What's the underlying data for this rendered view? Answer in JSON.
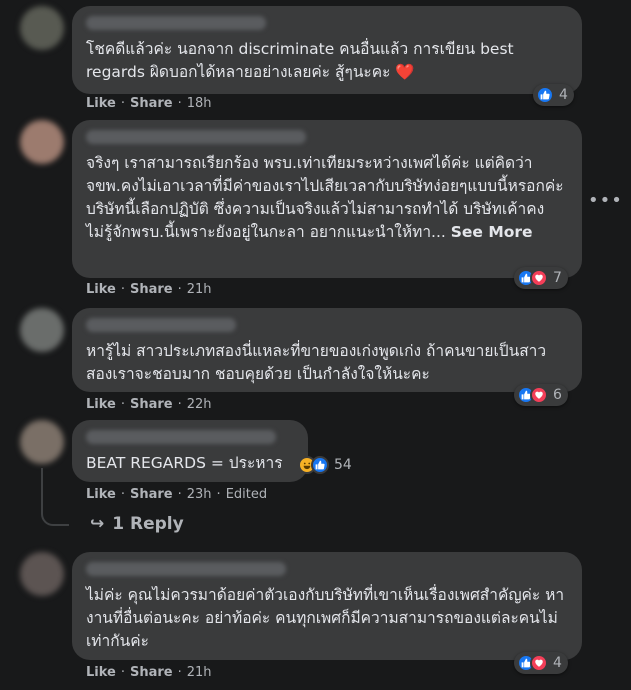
{
  "comments": [
    {
      "text": "โชคดีแล้วค่ะ นอกจาก discriminate คนอื่นแล้ว การเขียน best regards ผิดบอกได้หลายอย่างเลยค่ะ สู้ๆนะคะ",
      "emoji": "❤️",
      "like": "Like",
      "share": "Share",
      "time": "18h",
      "reaction_count": "4",
      "reaction_types": [
        "like"
      ]
    },
    {
      "text": "จริงๆ เราสามารถเรียกร้อง พรบ.เท่าเทียมระหว่างเพศได้ค่ะ แต่คิดว่า จขพ.คงไม่เอาเวลาที่มีค่าของเราไปเสียเวลากับบริษัทง่อยๆแบบนี้หรอกค่ะ บริษัทนี้เลือกปฏิบัติ ซึ่งความเป็นจริงแล้วไม่สามารถทำได้ บริษัทเค้าคงไม่รู้จักพรบ.นี้เพราะยังอยู่ในกะลา อยากแนะนำให้ทา...",
      "see_more": "See More",
      "like": "Like",
      "share": "Share",
      "time": "21h",
      "reaction_count": "7",
      "reaction_types": [
        "like",
        "love"
      ]
    },
    {
      "text": "หารู้ไม่ สาวประเภทสองนี่แหละที่ขายของเก่งพูดเก่ง ถ้าคนขายเป็นสาวสองเราจะชอบมาก ชอบคุยด้วย เป็นกำลังใจให้นะคะ",
      "like": "Like",
      "share": "Share",
      "time": "22h",
      "reaction_count": "6",
      "reaction_types": [
        "like",
        "love"
      ]
    },
    {
      "text": "BEAT REGARDS = ประหาร",
      "like": "Like",
      "share": "Share",
      "time": "23h",
      "edited": "Edited",
      "reaction_count": "54",
      "reaction_types": [
        "haha",
        "like"
      ],
      "replies_label": "1 Reply"
    },
    {
      "text": "ไม่ค่ะ คุณไม่ควรมาด้อยค่าตัวเองกับบริษัทที่เขาเห็นเรื่องเพศสำคัญค่ะ หางานที่อื่นต่อนะคะ อย่าท้อค่ะ คนทุกเพศก็มีความสามารถของแต่ละคนไม่เท่ากันค่ะ",
      "like": "Like",
      "share": "Share",
      "time": "21h",
      "reaction_count": "4",
      "reaction_types": [
        "like",
        "love"
      ]
    }
  ],
  "colors": {
    "background": "#18191a",
    "bubble": "#3a3b3c",
    "text": "#e4e6eb",
    "muted": "#b0b3b8",
    "like_blue": "#1877f2",
    "love_red": "#f33e58",
    "haha_yellow": "#f7b125"
  },
  "icons": {
    "more_options": "more-horizontal-icon",
    "reply_arrow": "reply-arrow-icon"
  }
}
